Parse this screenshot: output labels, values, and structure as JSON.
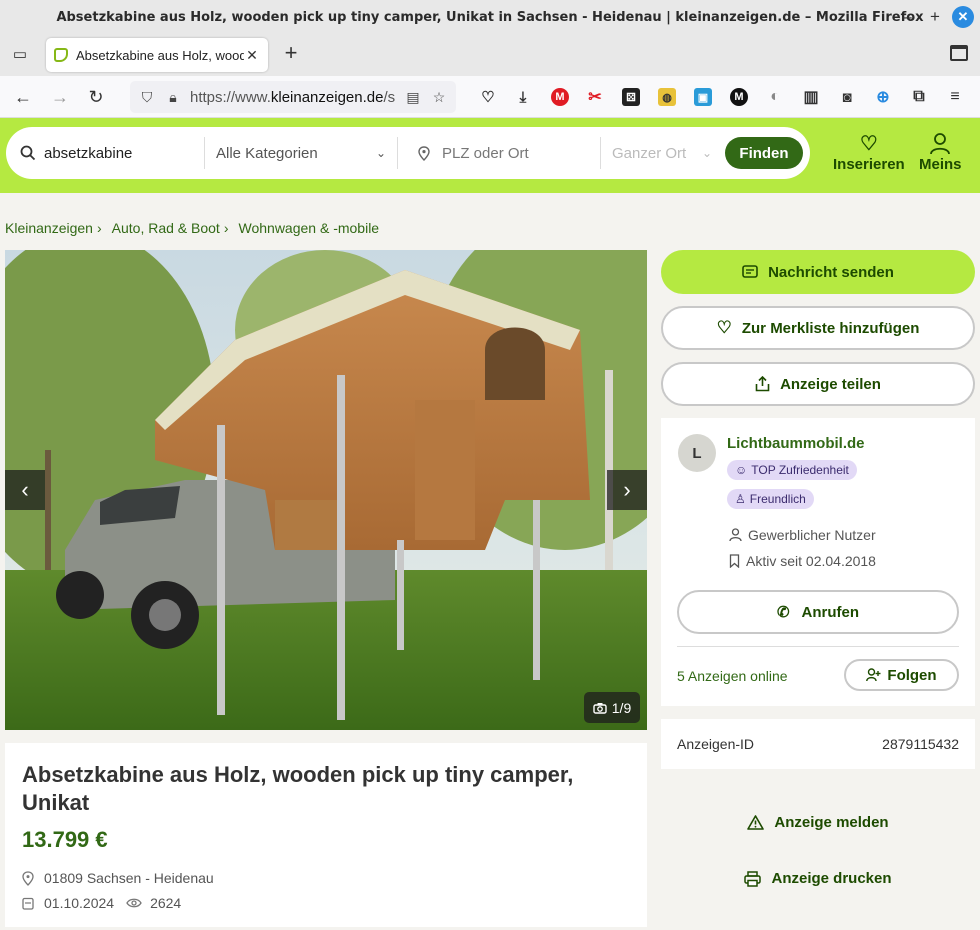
{
  "window": {
    "title": "Absetzkabine aus Holz, wooden pick up tiny camper, Unikat in Sachsen - Heidenau | kleinanzeigen.de – Mozilla Firefox",
    "minimize": "–",
    "maximize": "+",
    "close": "✕"
  },
  "tab": {
    "title": "Absetzkabine aus Holz, wooden",
    "close": "✕",
    "new_tab": "+"
  },
  "navbar": {
    "url_prefix": "https://www.",
    "url_domain": "kleinanzeigen.de",
    "url_rest": "/s",
    "icons": [
      "back-icon",
      "forward-icon",
      "reload-icon",
      "shield-icon",
      "lock-icon",
      "reader-icon",
      "bookmark-star-icon",
      "pocket-icon",
      "download-icon",
      "extensions-icon",
      "menu-icon"
    ]
  },
  "header": {
    "search_query": "absetzkabine",
    "category": "Alle Kategorien",
    "location_placeholder": "PLZ oder Ort",
    "radius": "Ganzer Ort",
    "find_label": "Finden",
    "post_label": "Inserieren",
    "account_label": "Meins"
  },
  "breadcrumb": [
    "Kleinanzeigen",
    "Auto, Rad & Boot",
    "Wohnwagen & -mobile"
  ],
  "gallery": {
    "counter": "1/9",
    "prev": "‹",
    "next": "›"
  },
  "listing": {
    "title": "Absetzkabine aus Holz, wooden pick up tiny camper, Unikat",
    "price": "13.799 €",
    "location": "01809 Sachsen - Heidenau",
    "date": "01.10.2024",
    "views": "2624"
  },
  "actions": {
    "message": "Nachricht senden",
    "watchlist": "Zur Merkliste hinzufügen",
    "share": "Anzeige teilen",
    "report": "Anzeige melden",
    "print": "Anzeige drucken"
  },
  "seller": {
    "initial": "L",
    "name": "Lichtbaummobil.de",
    "badge_satisfaction": "TOP Zufriedenheit",
    "badge_friendly": "Freundlich",
    "type": "Gewerblicher Nutzer",
    "active_since": "Aktiv seit 02.04.2018",
    "call_label": "Anrufen",
    "ads_online": "5 Anzeigen online",
    "follow_label": "Folgen"
  },
  "ad_id": {
    "label": "Anzeigen-ID",
    "value": "2879115432"
  },
  "colors": {
    "brand_green": "#b5e941",
    "dark_green": "#326916",
    "badge_purple": "#e2d9f6"
  }
}
